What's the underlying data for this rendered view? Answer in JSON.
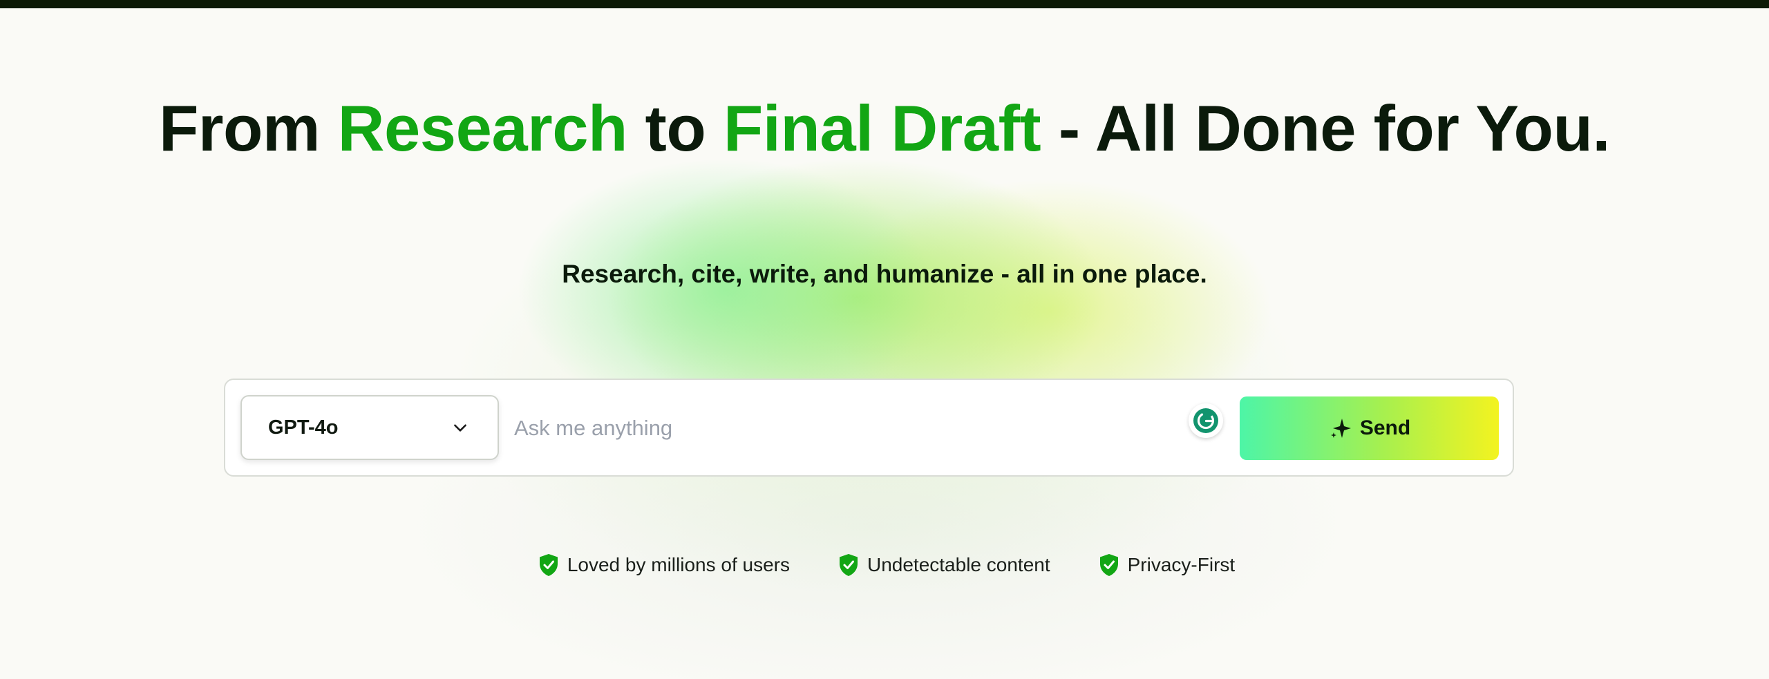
{
  "hero": {
    "headline": {
      "part1": "From ",
      "accent1": "Research",
      "part2": " to ",
      "accent2": "Final Draft",
      "part3": " - All Done for You."
    },
    "subheadline": "Research, cite, write, and humanize - all in one place."
  },
  "prompt": {
    "model_selected": "GPT-4o",
    "placeholder": "Ask me anything",
    "value": "",
    "send_label": "Send"
  },
  "features": [
    {
      "icon": "shield-check-icon",
      "label": "Loved by millions of users"
    },
    {
      "icon": "shield-check-icon",
      "label": "Undetectable content"
    },
    {
      "icon": "shield-check-icon",
      "label": "Privacy-First"
    }
  ],
  "colors": {
    "accent": "#12a614",
    "text_dark": "#0b1a0b",
    "top_bar": "#0c1a06",
    "send_gradient_start": "#4df5a7",
    "send_gradient_end": "#f3f320",
    "grammarly": "#15c39a"
  }
}
